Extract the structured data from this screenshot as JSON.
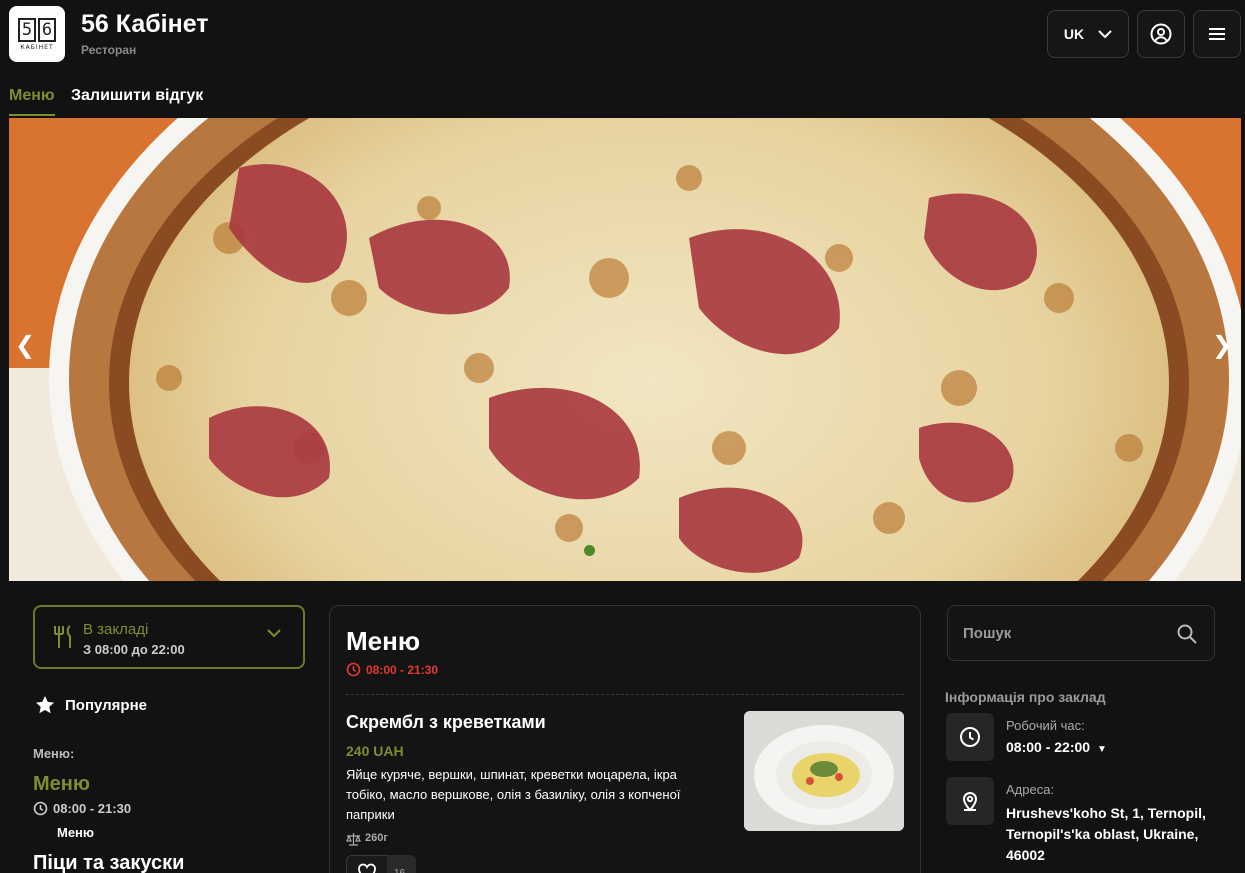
{
  "header": {
    "logo": {
      "digits": [
        "5",
        "6"
      ],
      "caption": "КАБІНЕТ"
    },
    "title": "56 Кабінет",
    "subtitle": "Ресторан",
    "language": "UK"
  },
  "tabs": [
    {
      "label": "Меню",
      "active": true
    },
    {
      "label": "Залишити відгук",
      "active": false
    }
  ],
  "hero": {
    "slide_count": 1,
    "active_slide": 1
  },
  "sidebar": {
    "place": {
      "title": "В закладі",
      "hours": "З 08:00 до 22:00"
    },
    "popular_label": "Популярне",
    "menu_section_label": "Меню:",
    "menus": [
      {
        "name": "Меню",
        "hours": "08:00 - 21:30",
        "sub": "Меню"
      }
    ],
    "next_category": "Піци та закуски"
  },
  "menu_card": {
    "title": "Меню",
    "hours": "08:00 - 21:30",
    "dish": {
      "name": "Скрембл з креветками",
      "price": "240 UAH",
      "description": "Яйце куряче, вершки, шпинат, креветки  моцарела, ікра тобіко, масло вершкове, олія з базиліку, олія з копченої паприки",
      "weight": "260г",
      "likes": "16"
    }
  },
  "info": {
    "search_placeholder": "Пошук",
    "section_title": "Інформація про заклад",
    "hours_label": "Робочий час:",
    "hours_value": "08:00 - 22:00",
    "address_label": "Адреса:",
    "address_value": "Hrushevs'koho St, 1, Ternopil, Ternopil's'ka oblast, Ukraine, 46002"
  },
  "colors": {
    "background": "#121212",
    "accent": "#7c8f2e",
    "hours_red": "#e53935",
    "slide_dot": "#4c8a2a"
  }
}
